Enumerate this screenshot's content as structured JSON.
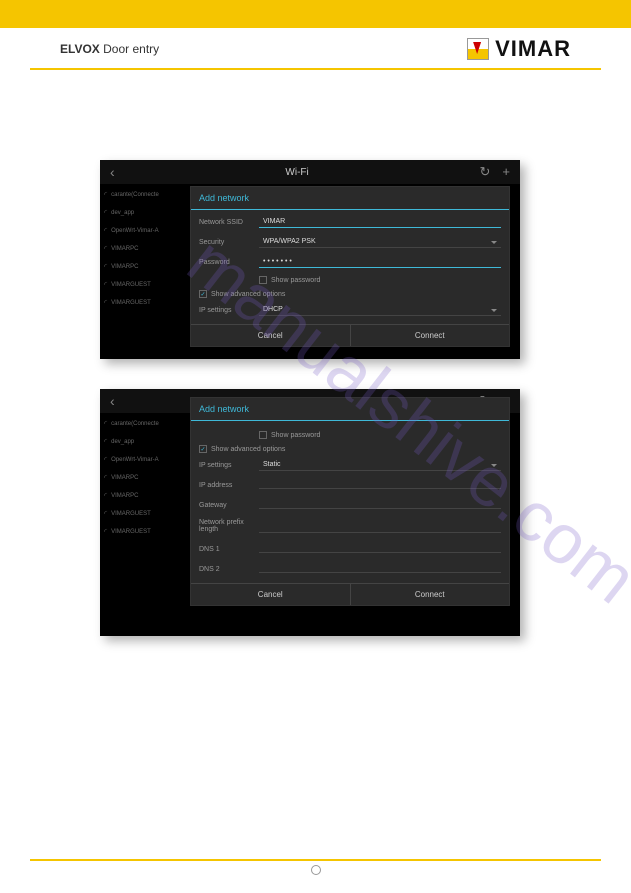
{
  "header": {
    "brand": "ELVOX",
    "product": "Door entry",
    "company": "VIMAR"
  },
  "screen1": {
    "topbar_title": "Wi-Fi",
    "wifi_list": [
      "carante(Connecte",
      "dev_app",
      "OpenWrt-Vimar-A",
      "VIMARPC",
      "VIMARPC",
      "VIMARGUEST",
      "VIMARGUEST"
    ],
    "dialog": {
      "title": "Add network",
      "ssid_label": "Network SSID",
      "ssid_value": "VIMAR",
      "security_label": "Security",
      "security_value": "WPA/WPA2 PSK",
      "password_label": "Password",
      "password_value": "• • • • • • •",
      "show_password": "Show password",
      "show_advanced": "Show advanced options",
      "ip_label": "IP settings",
      "ip_value": "DHCP",
      "cancel": "Cancel",
      "connect": "Connect"
    }
  },
  "screen2": {
    "wifi_list": [
      "carante(Connecte",
      "dev_app",
      "OpenWrt-Vimar-A",
      "VIMARPC",
      "VIMARPC",
      "VIMARGUEST",
      "VIMARGUEST"
    ],
    "dialog": {
      "title": "Add network",
      "show_password": "Show password",
      "show_advanced": "Show advanced options",
      "ip_label": "IP settings",
      "ip_value": "Static",
      "fields": [
        "IP address",
        "Gateway",
        "Network prefix length",
        "DNS 1",
        "DNS 2"
      ],
      "cancel": "Cancel",
      "connect": "Connect"
    }
  },
  "watermark": "manualshive.com"
}
